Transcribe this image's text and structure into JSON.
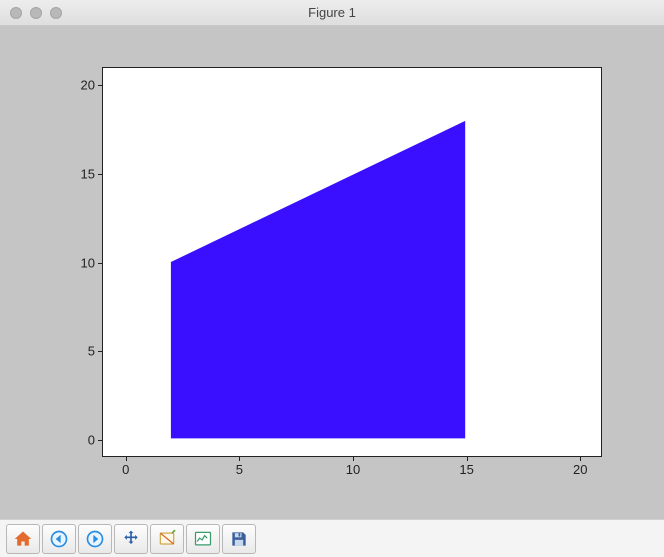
{
  "window": {
    "title": "Figure 1"
  },
  "chart_data": {
    "type": "area",
    "polygon_vertices": [
      {
        "x": 2,
        "y": 0
      },
      {
        "x": 2,
        "y": 10
      },
      {
        "x": 15,
        "y": 18
      },
      {
        "x": 15,
        "y": 0
      }
    ],
    "fill_color": "#3a0eff",
    "xlim": [
      -1,
      21
    ],
    "ylim": [
      -1,
      21
    ],
    "xticks": [
      0,
      5,
      10,
      15,
      20
    ],
    "yticks": [
      0,
      5,
      10,
      15,
      20
    ],
    "xlabel": "",
    "ylabel": "",
    "title": ""
  },
  "toolbar": {
    "items": [
      {
        "name": "home-icon",
        "label": "Home"
      },
      {
        "name": "back-icon",
        "label": "Back"
      },
      {
        "name": "forward-icon",
        "label": "Forward"
      },
      {
        "name": "pan-icon",
        "label": "Pan"
      },
      {
        "name": "zoom-icon",
        "label": "Zoom"
      },
      {
        "name": "subplots-icon",
        "label": "Configure subplots"
      },
      {
        "name": "save-icon",
        "label": "Save"
      }
    ]
  }
}
